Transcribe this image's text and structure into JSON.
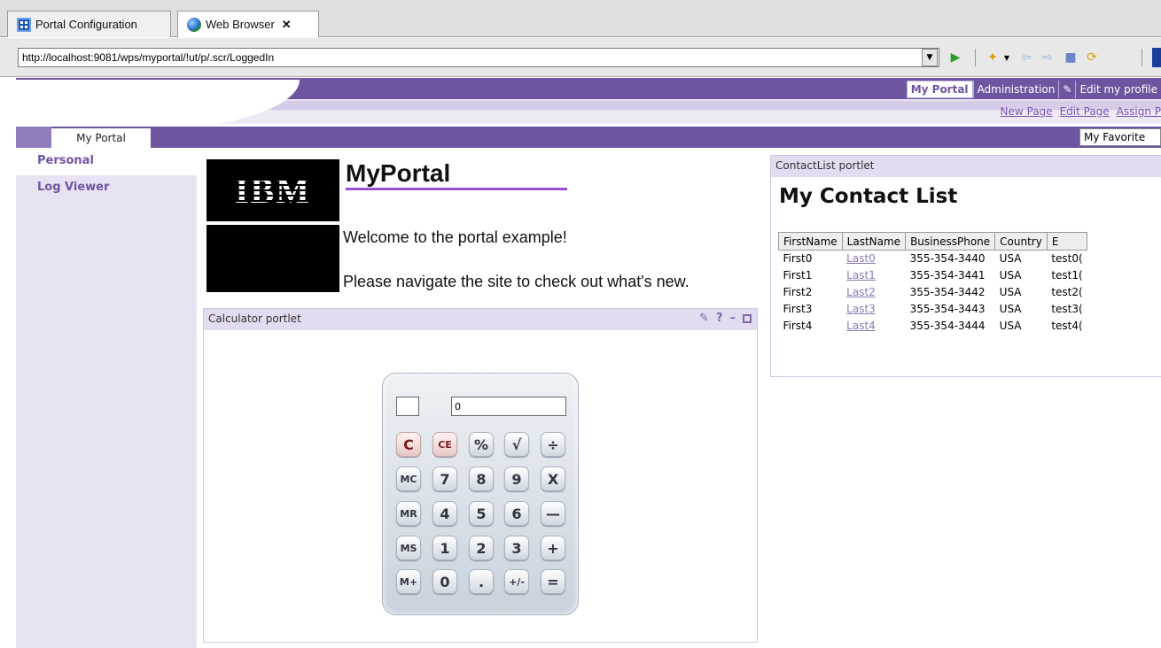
{
  "tabs": [
    {
      "label": "Portal Configuration",
      "active": false
    },
    {
      "label": "Web Browser",
      "active": true
    }
  ],
  "browser": {
    "url": "http://localhost:9081/wps/myportal/!ut/p/.scr/LoggedIn",
    "close_glyph": "✕"
  },
  "toolbar": {
    "go": "▶",
    "favorites": "✦",
    "back": "⇦",
    "forward": "⇨",
    "stop": "■",
    "refresh": "⟳"
  },
  "portal_nav": {
    "my_portal": "My Portal",
    "administration": "Administration",
    "edit_profile": "Edit my profile"
  },
  "page_actions": {
    "new_page": "New Page",
    "edit_page": "Edit Page",
    "assign": "Assign P"
  },
  "page_tab": "My Portal",
  "favorites_select": "My Favorite",
  "left_nav": [
    "Personal",
    "Log Viewer"
  ],
  "welcome": {
    "logo": "IBM",
    "title": "MyPortal",
    "message": "Welcome to the portal example!",
    "navigate": "Please navigate the site to check out what's new."
  },
  "calculator_portlet": {
    "title": "Calculator portlet",
    "display_value": "0",
    "controls": [
      "✎",
      "?",
      "–"
    ],
    "keys": [
      [
        "C",
        "CE",
        "%",
        "√",
        "÷"
      ],
      [
        "MC",
        "7",
        "8",
        "9",
        "X"
      ],
      [
        "MR",
        "4",
        "5",
        "6",
        "—"
      ],
      [
        "MS",
        "1",
        "2",
        "3",
        "+"
      ],
      [
        "M+",
        "0",
        ".",
        "+/-",
        "="
      ]
    ]
  },
  "contact_portlet": {
    "header": "ContactList portlet",
    "title": "My Contact List",
    "columns": [
      "FirstName",
      "LastName",
      "BusinessPhone",
      "Country",
      "E"
    ],
    "rows": [
      [
        "First0",
        "Last0",
        "355-354-3440",
        "USA",
        "test0("
      ],
      [
        "First1",
        "Last1",
        "355-354-3441",
        "USA",
        "test1("
      ],
      [
        "First2",
        "Last2",
        "355-354-3442",
        "USA",
        "test2("
      ],
      [
        "First3",
        "Last3",
        "355-354-3443",
        "USA",
        "test3("
      ],
      [
        "First4",
        "Last4",
        "355-354-3444",
        "USA",
        "test4("
      ]
    ]
  }
}
